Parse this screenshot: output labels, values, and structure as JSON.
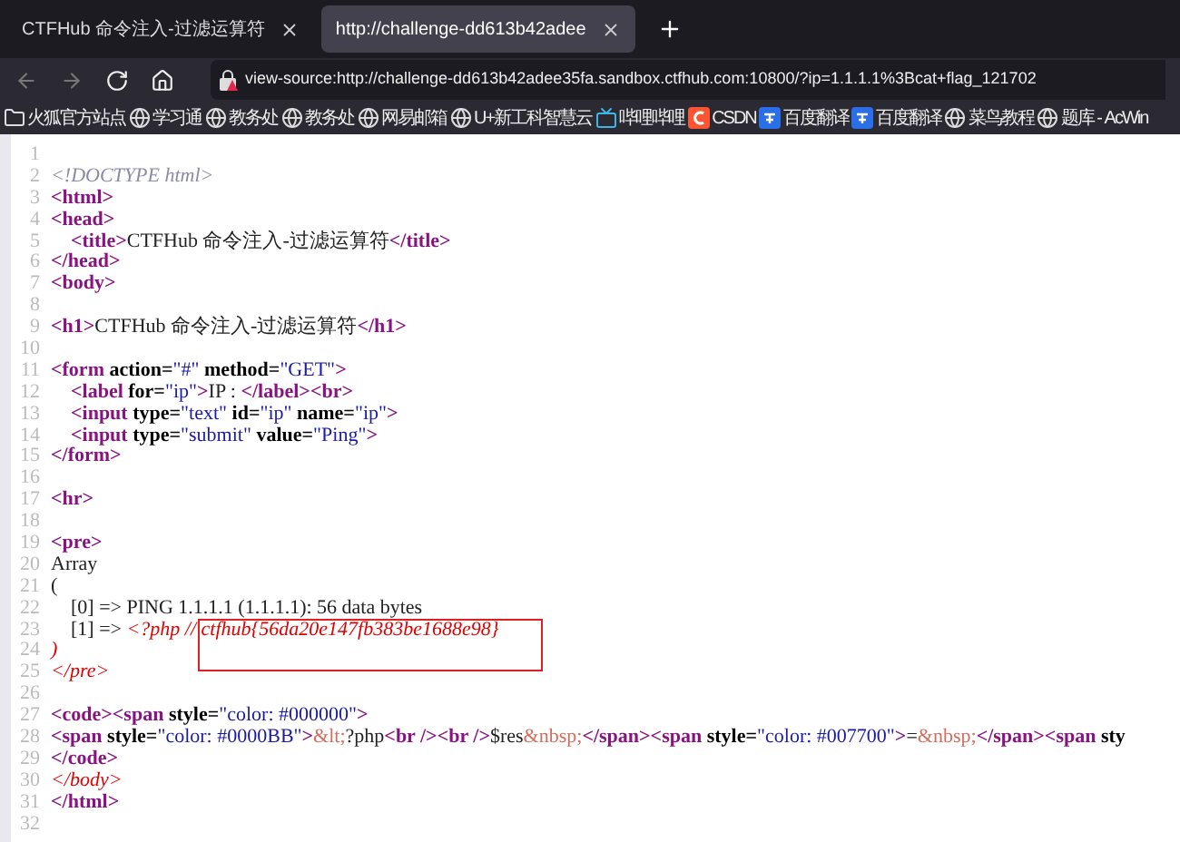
{
  "tabs": [
    {
      "title": "CTFHub 命令注入-过滤运算符",
      "selected": false
    },
    {
      "title": "http://challenge-dd613b42adee",
      "selected": true
    }
  ],
  "address_bar": {
    "url": "view-source:http://challenge-dd613b42adee35fa.sandbox.ctfhub.com:10800/?ip=1.1.1.1%3Bcat+flag_121702"
  },
  "bookmarks": [
    {
      "kind": "folder",
      "label": "火狐官方站点"
    },
    {
      "kind": "globe",
      "label": "学习通"
    },
    {
      "kind": "globe",
      "label": "教务处"
    },
    {
      "kind": "globe",
      "label": "教务处"
    },
    {
      "kind": "globe",
      "label": "网易邮箱"
    },
    {
      "kind": "globe",
      "label": "U+新工科智慧云"
    },
    {
      "kind": "tv",
      "label": "哔哩哔哩"
    },
    {
      "kind": "csdn",
      "label": "CSDN"
    },
    {
      "kind": "translate",
      "label": "百度翻译"
    },
    {
      "kind": "translate",
      "label": "百度翻译"
    },
    {
      "kind": "globe",
      "label": "菜鸟教程"
    },
    {
      "kind": "globe",
      "label": "题库 - AcWin"
    }
  ],
  "source_lines": [
    {
      "number": "1"
    },
    {
      "number": "2",
      "tokens": [
        {
          "kind": "comment",
          "text": "<!DOCTYPE html>"
        }
      ]
    },
    {
      "number": "3",
      "tokens": [
        {
          "kind": "tag",
          "text": "<html>"
        }
      ]
    },
    {
      "number": "4",
      "tokens": [
        {
          "kind": "tag",
          "text": "<head>"
        }
      ]
    },
    {
      "number": "5",
      "tokens": [
        {
          "kind": "tag",
          "text": "    <title>"
        },
        {
          "kind": "text",
          "text": "CTFHub 命令注入-过滤运算符"
        },
        {
          "kind": "tag",
          "text": "</title>"
        }
      ]
    },
    {
      "number": "6",
      "tokens": [
        {
          "kind": "tag",
          "text": "</head>"
        }
      ]
    },
    {
      "number": "7",
      "tokens": [
        {
          "kind": "tag",
          "text": "<body>"
        }
      ]
    },
    {
      "number": "8"
    },
    {
      "number": "9",
      "tokens": [
        {
          "kind": "tag",
          "text": "<h1>"
        },
        {
          "kind": "text",
          "text": "CTFHub 命令注入-过滤运算符"
        },
        {
          "kind": "tag",
          "text": "</h1>"
        }
      ]
    },
    {
      "number": "10"
    },
    {
      "number": "11",
      "tokens": [
        {
          "kind": "tag",
          "text": "<form"
        },
        {
          "kind": "attr",
          "text": " action="
        },
        {
          "kind": "value",
          "text": "\"#\""
        },
        {
          "kind": "attr",
          "text": " method="
        },
        {
          "kind": "value",
          "text": "\"GET\""
        },
        {
          "kind": "tag",
          "text": ">"
        }
      ]
    },
    {
      "number": "12",
      "tokens": [
        {
          "kind": "tag",
          "text": "    <label"
        },
        {
          "kind": "attr",
          "text": " for="
        },
        {
          "kind": "value",
          "text": "\"ip\""
        },
        {
          "kind": "tag",
          "text": ">"
        },
        {
          "kind": "text",
          "text": "IP : "
        },
        {
          "kind": "tag",
          "text": "</label><br>"
        }
      ]
    },
    {
      "number": "13",
      "tokens": [
        {
          "kind": "tag",
          "text": "    <input"
        },
        {
          "kind": "attr",
          "text": " type="
        },
        {
          "kind": "value",
          "text": "\"text\""
        },
        {
          "kind": "attr",
          "text": " id="
        },
        {
          "kind": "value",
          "text": "\"ip\""
        },
        {
          "kind": "attr",
          "text": " name="
        },
        {
          "kind": "value",
          "text": "\"ip\""
        },
        {
          "kind": "tag",
          "text": ">"
        }
      ]
    },
    {
      "number": "14",
      "tokens": [
        {
          "kind": "tag",
          "text": "    <input"
        },
        {
          "kind": "attr",
          "text": " type="
        },
        {
          "kind": "value",
          "text": "\"submit\""
        },
        {
          "kind": "attr",
          "text": " value="
        },
        {
          "kind": "value",
          "text": "\"Ping\""
        },
        {
          "kind": "tag",
          "text": ">"
        }
      ]
    },
    {
      "number": "15",
      "tokens": [
        {
          "kind": "tag",
          "text": "</form>"
        }
      ]
    },
    {
      "number": "16"
    },
    {
      "number": "17",
      "tokens": [
        {
          "kind": "tag",
          "text": "<hr>"
        }
      ]
    },
    {
      "number": "18"
    },
    {
      "number": "19",
      "tokens": [
        {
          "kind": "tag",
          "text": "<pre>"
        }
      ]
    },
    {
      "number": "20",
      "tokens": [
        {
          "kind": "text",
          "text": "Array"
        }
      ]
    },
    {
      "number": "21",
      "tokens": [
        {
          "kind": "text",
          "text": "("
        }
      ]
    },
    {
      "number": "22",
      "tokens": [
        {
          "kind": "text",
          "text": "    [0] => PING 1.1.1.1 (1.1.1.1): 56 data bytes"
        }
      ]
    },
    {
      "number": "23",
      "tokens": [
        {
          "kind": "text",
          "text": "    [1] => "
        },
        {
          "kind": "error",
          "text": "<?php //"
        },
        {
          "kind": "error",
          "text": " ctfhub{56da20e147fb383be1688e98}"
        }
      ]
    },
    {
      "number": "24",
      "tokens": [
        {
          "kind": "error",
          "text": ")"
        }
      ]
    },
    {
      "number": "25",
      "tokens": [
        {
          "kind": "error",
          "text": "</pre>"
        }
      ]
    },
    {
      "number": "26"
    },
    {
      "number": "27",
      "tokens": [
        {
          "kind": "tag",
          "text": "<code><span"
        },
        {
          "kind": "attr",
          "text": " style="
        },
        {
          "kind": "value",
          "text": "\"color: #000000\""
        },
        {
          "kind": "tag",
          "text": ">"
        }
      ]
    },
    {
      "number": "28",
      "tokens": [
        {
          "kind": "tag",
          "text": "<span"
        },
        {
          "kind": "attr",
          "text": " style="
        },
        {
          "kind": "value",
          "text": "\"color: #0000BB\""
        },
        {
          "kind": "tag",
          "text": ">"
        },
        {
          "kind": "entity",
          "text": "&lt;"
        },
        {
          "kind": "text",
          "text": "?php"
        },
        {
          "kind": "tag",
          "text": "<br /><br />"
        },
        {
          "kind": "text",
          "text": "$res"
        },
        {
          "kind": "entity",
          "text": "&nbsp;"
        },
        {
          "kind": "tag",
          "text": "</span><span"
        },
        {
          "kind": "attr",
          "text": " style="
        },
        {
          "kind": "value",
          "text": "\"color: #007700\""
        },
        {
          "kind": "tag",
          "text": ">"
        },
        {
          "kind": "text",
          "text": "="
        },
        {
          "kind": "entity",
          "text": "&nbsp;"
        },
        {
          "kind": "tag",
          "text": "</span><span"
        },
        {
          "kind": "attr",
          "text": " sty"
        }
      ]
    },
    {
      "number": "29",
      "tokens": [
        {
          "kind": "tag",
          "text": "</code>"
        }
      ]
    },
    {
      "number": "30",
      "tokens": [
        {
          "kind": "error",
          "text": "</body>"
        }
      ]
    },
    {
      "number": "31",
      "tokens": [
        {
          "kind": "tag",
          "text": "</html>"
        }
      ]
    },
    {
      "number": "32"
    }
  ]
}
